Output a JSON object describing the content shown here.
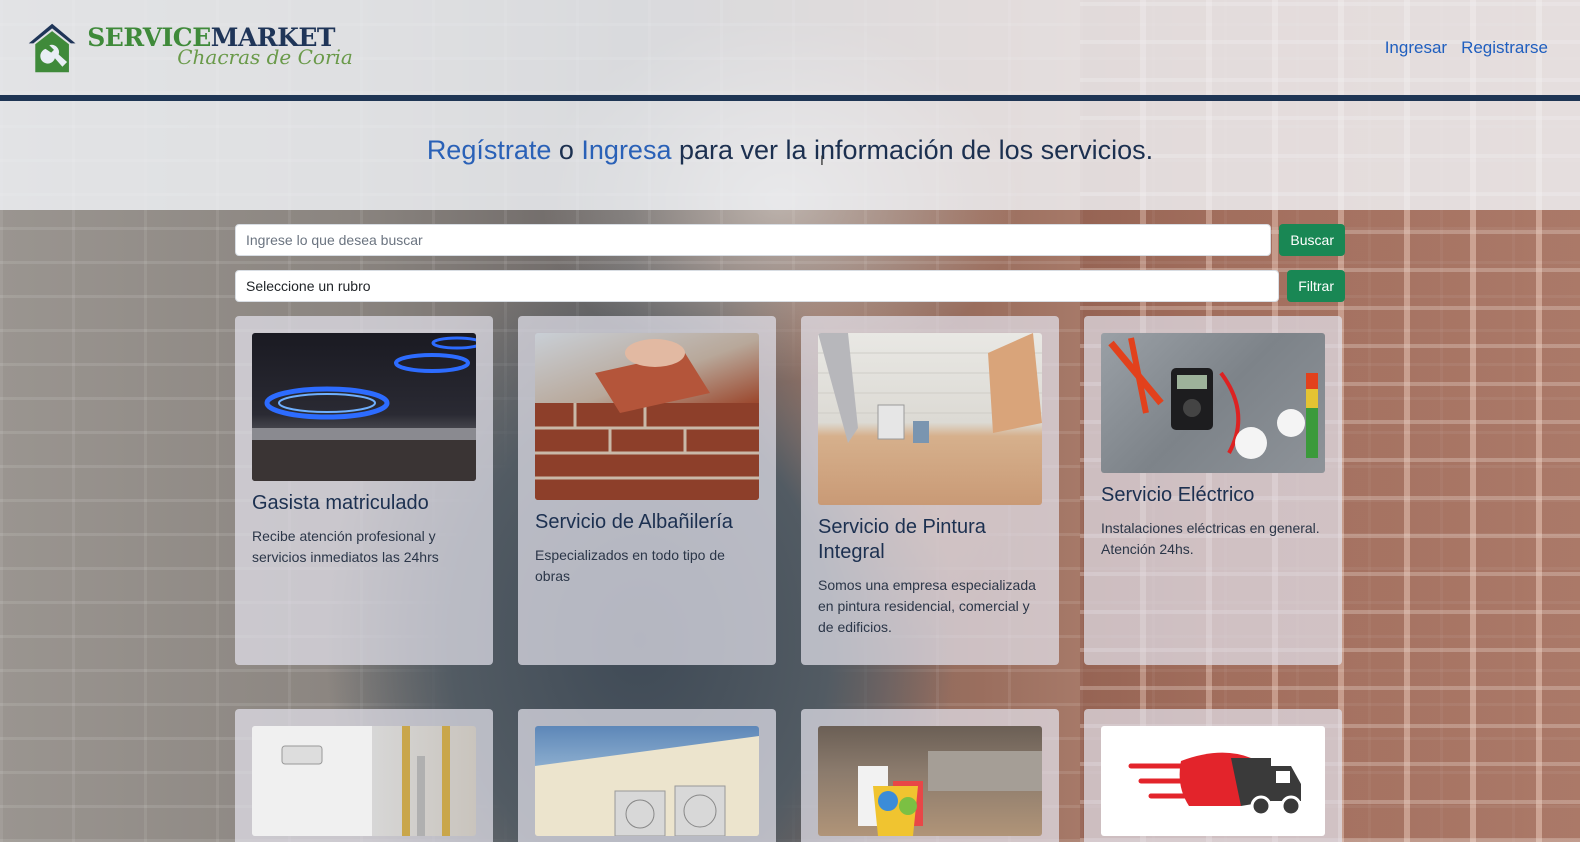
{
  "header": {
    "logo": {
      "service": "SERVICE",
      "market": "MARKET",
      "town": "Chacras de Coria"
    },
    "nav": {
      "login": "Ingresar",
      "register": "Registrarse"
    }
  },
  "banner": {
    "register_link": "Regístrate",
    "or": " o ",
    "login_link": "Ingresa",
    "rest": " para ver la información de los servicios."
  },
  "search": {
    "placeholder": "Ingrese lo que desea buscar",
    "search_button": "Buscar",
    "category_value": "Seleccione un rubro",
    "filter_button": "Filtrar"
  },
  "cards": [
    {
      "title": "Gasista matriculado",
      "description": "Recibe atención profesional y servicios inmediatos las 24hrs",
      "image": "gas-stove-flame"
    },
    {
      "title": "Servicio de Albañilería",
      "description": "Especializados en todo tipo de obras",
      "image": "bricklaying"
    },
    {
      "title": "Servicio de Pintura Integral",
      "description": "Somos una empresa especializada en pintura residencial, comercial y de edificios.",
      "image": "painting-room"
    },
    {
      "title": "Servicio Eléctrico",
      "description": "Instalaciones eléctricas en general. Atención 24hs.",
      "image": "electrical-tools"
    }
  ],
  "cards_row2": [
    {
      "image": "water-heater"
    },
    {
      "image": "air-conditioner"
    },
    {
      "image": "cleaning-supplies"
    },
    {
      "image": "delivery-truck"
    }
  ],
  "colors": {
    "primary_link": "#1f5fbf",
    "header_bar": "#1e3554",
    "button_green": "#198754",
    "logo_green": "#3f8a3a",
    "logo_navy": "#1f3558"
  }
}
